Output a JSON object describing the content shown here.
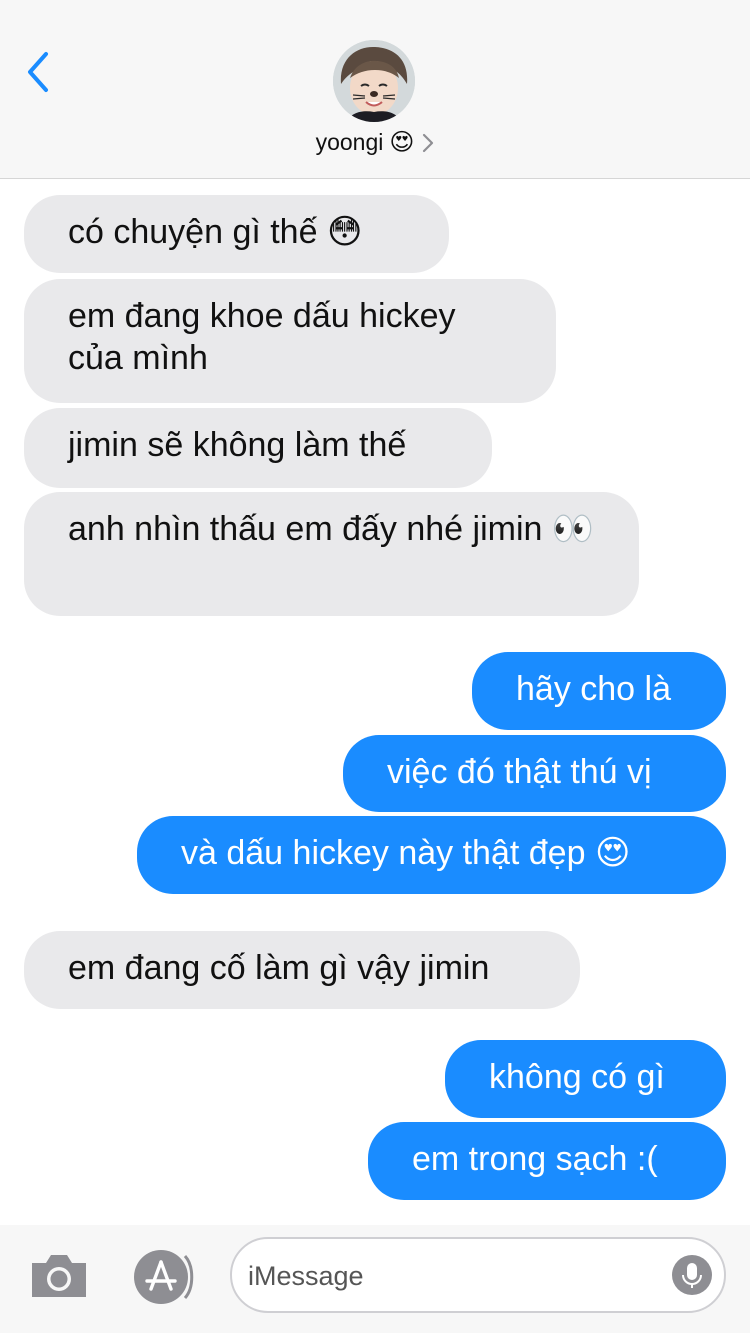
{
  "header": {
    "contact_name": "yoongi",
    "contact_emoji": "😍",
    "back_icon": "chevron-left-icon",
    "detail_icon": "chevron-right-icon"
  },
  "messages": [
    {
      "side": "incoming",
      "text": "có chuyện gì thế 😳"
    },
    {
      "side": "incoming",
      "text": "em đang khoe dấu hickey của mình"
    },
    {
      "side": "incoming",
      "text": "jimin sẽ không làm thế"
    },
    {
      "side": "incoming",
      "text": "anh nhìn thấu em đấy nhé jimin 👀"
    },
    {
      "side": "outgoing",
      "text": "hãy cho là"
    },
    {
      "side": "outgoing",
      "text": "việc đó thật thú vị"
    },
    {
      "side": "outgoing",
      "text": "và dấu hickey này thật đẹp 😍"
    },
    {
      "side": "incoming",
      "text": "em đang cố làm gì vậy jimin"
    },
    {
      "side": "outgoing",
      "text": "không có gì"
    },
    {
      "side": "outgoing",
      "text": "em trong sạch :("
    }
  ],
  "composer": {
    "placeholder": "iMessage",
    "value": "",
    "camera_icon": "camera-icon",
    "apps_icon": "app-store-icon",
    "mic_icon": "microphone-icon"
  },
  "colors": {
    "outgoing_bubble": "#1a8cff",
    "incoming_bubble": "#e9e9eb",
    "accent": "#1a8cff"
  }
}
